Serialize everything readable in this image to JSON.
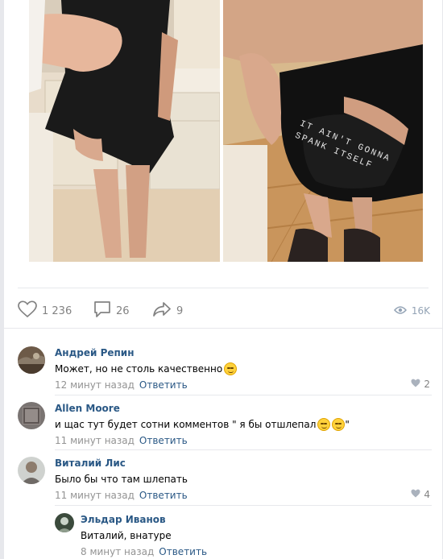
{
  "post": {
    "photos": [
      {
        "alt": "photo-left"
      },
      {
        "alt": "photo-right",
        "caption": "IT AIN'T GONNA SPANK ITSELF"
      }
    ],
    "actions": {
      "likes": "1 236",
      "comments": "26",
      "shares": "9",
      "views": "16K"
    }
  },
  "comments": [
    {
      "author": "Андрей Репин",
      "text": "Может, но не столь качественно",
      "time": "12 минут назад",
      "reply": "Ответить",
      "likes": "2"
    },
    {
      "author": "Allen Moore",
      "text_before": "и щас тут будет сотни комментов \" я бы отшлепал",
      "text_after": "\"",
      "time": "11 минут назад",
      "reply": "Ответить"
    },
    {
      "author": "Виталий Лис",
      "text": "Было бы что там шлепать",
      "time": "11 минут назад",
      "reply": "Ответить",
      "likes": "4"
    },
    {
      "author": "Эльдар Иванов",
      "text": "Виталий, внатуре",
      "time": "8 минут назад",
      "reply": "Ответить"
    }
  ],
  "colors": {
    "link": "#2a5885",
    "meta": "#939393",
    "icon": "#828282",
    "separator": "#e7e8ec"
  }
}
